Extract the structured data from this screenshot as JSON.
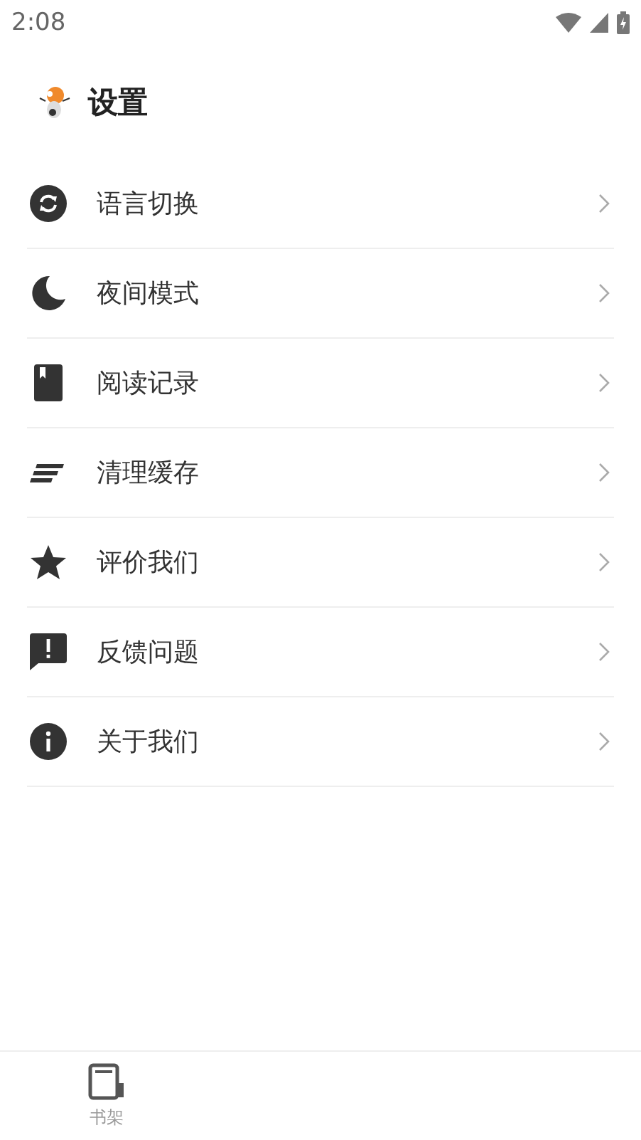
{
  "status_bar": {
    "time": "2:08"
  },
  "header": {
    "title": "设置"
  },
  "settings": [
    {
      "kind": "language",
      "label": "语言切换"
    },
    {
      "kind": "night",
      "label": "夜间模式"
    },
    {
      "kind": "history",
      "label": "阅读记录"
    },
    {
      "kind": "cache",
      "label": "清理缓存"
    },
    {
      "kind": "rate",
      "label": "评价我们"
    },
    {
      "kind": "feedback",
      "label": "反馈问题"
    },
    {
      "kind": "about",
      "label": "关于我们"
    }
  ],
  "bottom_nav": [
    {
      "label": "书架",
      "selected": false
    }
  ]
}
